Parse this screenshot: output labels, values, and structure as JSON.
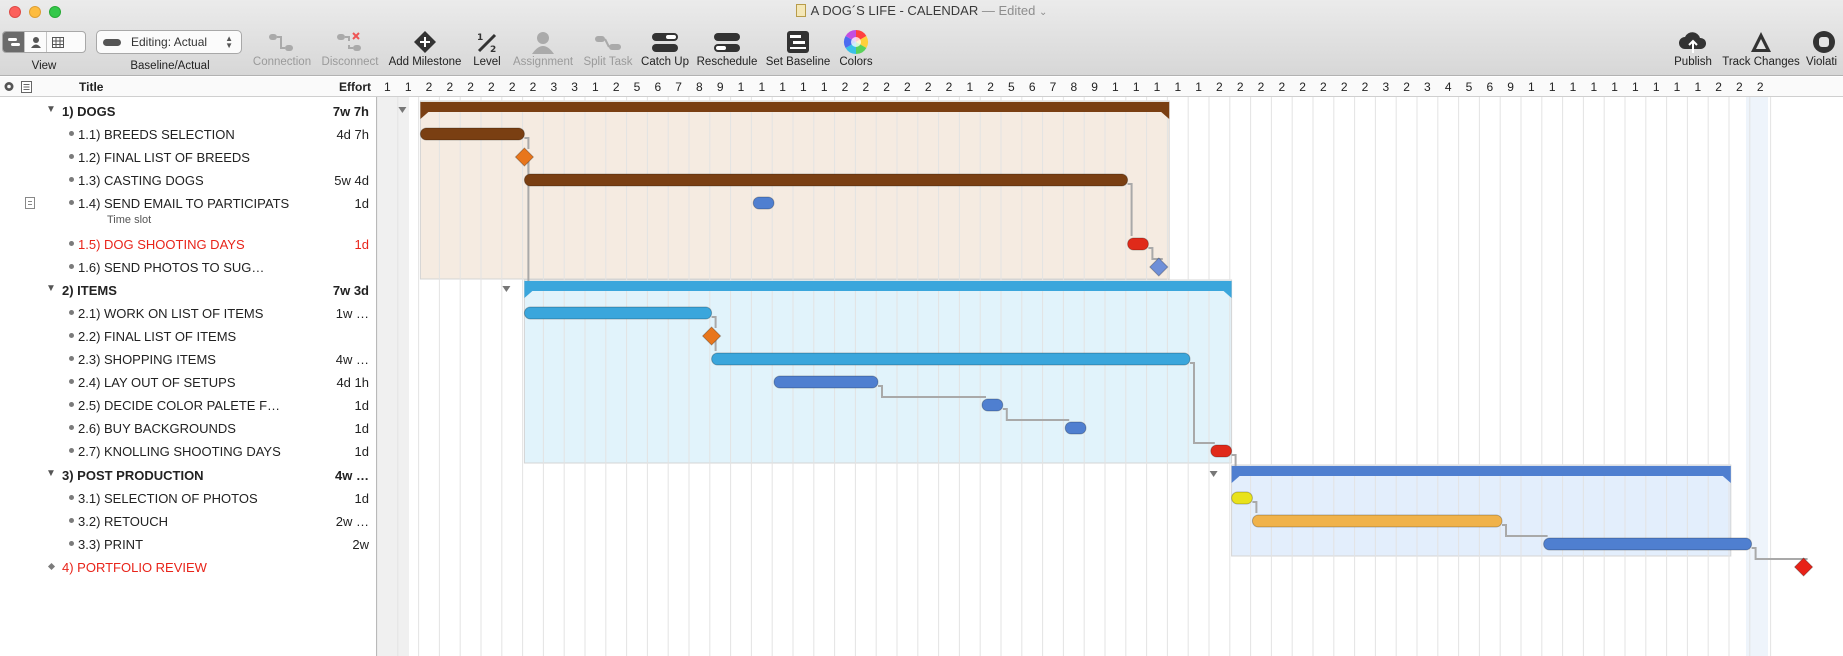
{
  "window": {
    "title": "A DOG´S LIFE - CALENDAR",
    "status": "— Edited",
    "chevron": "⌄"
  },
  "toolbar": {
    "view_label": "View",
    "baseline_label": "Baseline/Actual",
    "baseline_value": "Editing: Actual",
    "connection_label": "Connection",
    "disconnect_label": "Disconnect",
    "add_milestone_label": "Add Milestone",
    "level_label": "Level",
    "assignment_label": "Assignment",
    "split_task_label": "Split Task",
    "catch_up_label": "Catch Up",
    "reschedule_label": "Reschedule",
    "set_baseline_label": "Set Baseline",
    "colors_label": "Colors",
    "publish_label": "Publish",
    "track_changes_label": "Track Changes",
    "violations_label": "Violati"
  },
  "outline": {
    "title_header": "Title",
    "effort_header": "Effort",
    "rows": [
      {
        "num": "1)",
        "title": "DOGS",
        "effort": "7w 7h",
        "type": "group"
      },
      {
        "num": "1.1)",
        "title": "BREEDS SELECTION",
        "effort": "4d 7h"
      },
      {
        "num": "1.2)",
        "title": "FINAL LIST OF BREEDS",
        "effort": ""
      },
      {
        "num": "1.3)",
        "title": "CASTING DOGS",
        "effort": "5w 4d"
      },
      {
        "num": "1.4)",
        "title": "SEND EMAIL TO PARTICIPATS",
        "effort": "1d",
        "note": "Time slot"
      },
      {
        "num": "1.5)",
        "title": "DOG SHOOTING DAYS",
        "effort": "1d",
        "red": true
      },
      {
        "num": "1.6)",
        "title": "SEND PHOTOS TO SUG…",
        "effort": ""
      },
      {
        "num": "2)",
        "title": "ITEMS",
        "effort": "7w 3d",
        "type": "group"
      },
      {
        "num": "2.1)",
        "title": "WORK ON LIST OF ITEMS",
        "effort": "1w …"
      },
      {
        "num": "2.2)",
        "title": "FINAL LIST OF ITEMS",
        "effort": ""
      },
      {
        "num": "2.3)",
        "title": "SHOPPING ITEMS",
        "effort": "4w …"
      },
      {
        "num": "2.4)",
        "title": "LAY OUT OF SETUPS",
        "effort": "4d 1h"
      },
      {
        "num": "2.5)",
        "title": "DECIDE COLOR PALETE F…",
        "effort": "1d"
      },
      {
        "num": "2.6)",
        "title": "BUY BACKGROUNDS",
        "effort": "1d"
      },
      {
        "num": "2.7)",
        "title": "KNOLLING SHOOTING DAYS",
        "effort": "1d"
      },
      {
        "num": "3)",
        "title": "POST PRODUCTION",
        "effort": "4w …",
        "type": "group"
      },
      {
        "num": "3.1)",
        "title": "SELECTION OF PHOTOS",
        "effort": "1d"
      },
      {
        "num": "3.2)",
        "title": "RETOUCH",
        "effort": "2w …"
      },
      {
        "num": "3.3)",
        "title": "PRINT",
        "effort": "2w"
      },
      {
        "num": "4)",
        "title": "PORTFOLIO REVIEW",
        "effort": "",
        "type": "milestone-top",
        "red": true
      }
    ]
  },
  "gantt": {
    "day_numbers": [
      "1",
      "1",
      "2",
      "2",
      "2",
      "2",
      "2",
      "2",
      "3",
      "3",
      "1",
      "2",
      "5",
      "6",
      "7",
      "8",
      "9",
      "1",
      "1",
      "1",
      "1",
      "1",
      "2",
      "2",
      "2",
      "2",
      "2",
      "2",
      "1",
      "2",
      "5",
      "6",
      "7",
      "8",
      "9",
      "1",
      "1",
      "1",
      "1",
      "1",
      "2",
      "2",
      "2",
      "2",
      "2",
      "2",
      "2",
      "2",
      "3",
      "2",
      "3",
      "4",
      "5",
      "6",
      "9",
      "1",
      "1",
      "1",
      "1",
      "1",
      "1",
      "1",
      "1",
      "1",
      "2",
      "2",
      "2"
    ],
    "colors": {
      "dogs": "#7a3f12",
      "items": "#3aa6dc",
      "post": "#4f7fd0",
      "milestone_orange": "#e8761c",
      "milestone_blue": "#6f8fd8",
      "milestone_red": "#e82218",
      "task_red": "#e02a1a",
      "task_yellow": "#e9e21c",
      "task_orange": "#f0b24a"
    },
    "tasks": [
      {
        "row": 0,
        "kind": "group",
        "start": 0.5,
        "dur": 36,
        "color": "dogs",
        "bg": "#f5ebe1",
        "span": [
          0,
          6
        ]
      },
      {
        "row": 1,
        "kind": "bar",
        "start": 0.5,
        "dur": 5,
        "color": "dogs"
      },
      {
        "row": 2,
        "kind": "milestone",
        "start": 5.5,
        "color": "milestone_orange"
      },
      {
        "row": 3,
        "kind": "bar",
        "start": 5.5,
        "dur": 29,
        "color": "dogs"
      },
      {
        "row": 4,
        "kind": "pill",
        "start": 16.5,
        "dur": 1,
        "color": "post"
      },
      {
        "row": 5,
        "kind": "pill",
        "start": 34.5,
        "dur": 1,
        "color": "task_red"
      },
      {
        "row": 6,
        "kind": "milestone",
        "start": 36.0,
        "color": "milestone_blue"
      },
      {
        "row": 7,
        "kind": "group",
        "start": 5.5,
        "dur": 34,
        "color": "items",
        "bg": "#e1f3fb",
        "span": [
          7,
          14
        ]
      },
      {
        "row": 8,
        "kind": "bar",
        "start": 5.5,
        "dur": 9,
        "color": "items"
      },
      {
        "row": 9,
        "kind": "milestone",
        "start": 14.5,
        "color": "milestone_orange"
      },
      {
        "row": 10,
        "kind": "bar",
        "start": 14.5,
        "dur": 23,
        "color": "items"
      },
      {
        "row": 11,
        "kind": "bar",
        "start": 17.5,
        "dur": 5,
        "color": "post"
      },
      {
        "row": 12,
        "kind": "pill",
        "start": 27.5,
        "dur": 1,
        "color": "post"
      },
      {
        "row": 13,
        "kind": "pill",
        "start": 31.5,
        "dur": 1,
        "color": "post"
      },
      {
        "row": 14,
        "kind": "pill",
        "start": 38.5,
        "dur": 1,
        "color": "task_red"
      },
      {
        "row": 15,
        "kind": "group",
        "start": 39.5,
        "dur": 24,
        "color": "post",
        "bg": "#e3eefc",
        "span": [
          15,
          18
        ]
      },
      {
        "row": 16,
        "kind": "pill",
        "start": 39.5,
        "dur": 1,
        "color": "task_yellow"
      },
      {
        "row": 17,
        "kind": "bar",
        "start": 40.5,
        "dur": 12,
        "color": "task_orange"
      },
      {
        "row": 18,
        "kind": "bar",
        "start": 54.5,
        "dur": 10,
        "color": "post"
      },
      {
        "row": 19,
        "kind": "milestone",
        "start": 67.0,
        "color": "milestone_red"
      }
    ],
    "links": [
      [
        1,
        2
      ],
      [
        2,
        3
      ],
      [
        3,
        5
      ],
      [
        5,
        6
      ],
      [
        2,
        7
      ],
      [
        8,
        9
      ],
      [
        9,
        10
      ],
      [
        11,
        12
      ],
      [
        12,
        13
      ],
      [
        10,
        14
      ],
      [
        14,
        15
      ],
      [
        16,
        17
      ],
      [
        17,
        18
      ],
      [
        18,
        19
      ]
    ]
  }
}
